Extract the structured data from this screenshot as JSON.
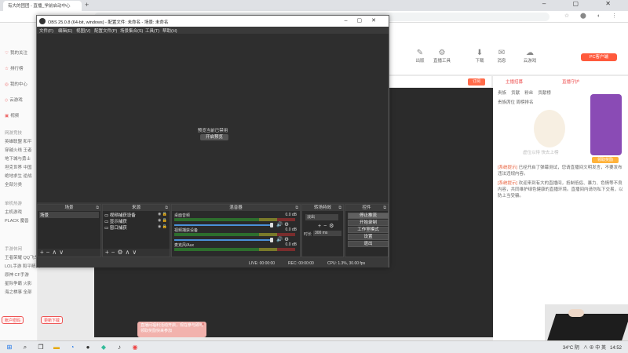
{
  "browser": {
    "tab_title": "有大的团团 - 直播_学前启动中心",
    "new_tab": "+",
    "window_controls": "–  ▢  ✕"
  },
  "sidebar": {
    "items": [
      {
        "icon": "♡",
        "label": "我的关注"
      },
      {
        "icon": "☆",
        "label": "排行榜"
      },
      {
        "icon": "◎",
        "label": "我的中心"
      },
      {
        "icon": "◇",
        "label": "云游戏"
      },
      {
        "icon": "▣",
        "label": "视频"
      }
    ],
    "groups": [
      {
        "title": "网游竞技",
        "lines": [
          "英雄联盟 和平",
          "穿越火线 王者",
          "地下城与勇士",
          "坦克世界 中国",
          "绝地求生 逆战",
          "全部分类"
        ]
      },
      {
        "title": "单机热游",
        "lines": [
          "主机游戏",
          "PLACK 魔兽"
        ]
      },
      {
        "title": "手游休闲",
        "lines": [
          "王者荣耀 QQ飞车",
          "LOL手游 和平精英",
          "原神 CF手游",
          "星际争霸 火影",
          "海之棋事 全部"
        ]
      }
    ],
    "btn_left": "账户密码",
    "btn_right": "更新下载"
  },
  "page": {
    "icons": [
      "出版",
      "直播工具",
      "下载",
      "消息",
      "云游戏"
    ],
    "pc_button": "PC客户端",
    "sub_btn": "订阅",
    "right_tabs": [
      "主播招募",
      "直播守护"
    ],
    "right_row2": [
      "贵族",
      "贡献",
      "粉丝",
      "贡献榜"
    ],
    "right_row3": "贵族席位 周榜排名",
    "mascot_text": "虚位以待 快去上榜",
    "award_label": "领取奖励",
    "notice1_tag": "[系统提示]",
    "notice1": "已经开启了弹幕测试，您请直播间文明发言，不要发布违法违规内容。",
    "notice2_tag": "[系统提示]",
    "notice2": "欢迎来到有大的直播间，抵制低俗、暴力、色情等不良内容，共同维护绿色健康的直播环境。直播间内请勿私下交易，以防上当受骗。",
    "promo_text": "直播间福利活动开启，现在参与即可领取奖励快来参加",
    "promo_close": "✕"
  },
  "obs": {
    "title": "OBS 25.0.8 (64-bit, windows) - 配置文件: 未命名 - 场景: 未命名",
    "menu": [
      "文件(F)",
      "编辑(E)",
      "视图(V)",
      "配置文件(P)",
      "场景集合(S)",
      "工具(T)",
      "帮助(H)"
    ],
    "preview_msg": "预览当前已禁用",
    "preview_btn": "开启预览",
    "docks": {
      "scenes": {
        "title": "场景",
        "items": [
          "场景"
        ]
      },
      "sources": {
        "title": "来源",
        "items": [
          "视频捕获设备",
          "显示捕获",
          "窗口捕获"
        ]
      },
      "mixer": {
        "title": "混音器",
        "channels": [
          {
            "name": "桌面音频",
            "db": "0.0 dB"
          },
          {
            "name": "视频捕获设备",
            "db": "0.0 dB"
          },
          {
            "name": "麦克风/Aux",
            "db": "0.0 dB"
          }
        ]
      },
      "transitions": {
        "title": "转场特效",
        "select": "淡出",
        "duration_label": "时长",
        "duration": "300 ms"
      },
      "controls": {
        "title": "控件",
        "buttons": [
          "停止推流",
          "开始录制",
          "工作室模式",
          "设置",
          "退出"
        ]
      }
    },
    "status": {
      "live": "LIVE: 00:00:00",
      "rec": "REC: 00:00:00",
      "cpu": "CPU: 1.3%, 30.00 fps"
    }
  },
  "taskbar": {
    "weather": "34°C 阴",
    "right": "∧  ⊕  中  英",
    "clock": "14:52"
  }
}
